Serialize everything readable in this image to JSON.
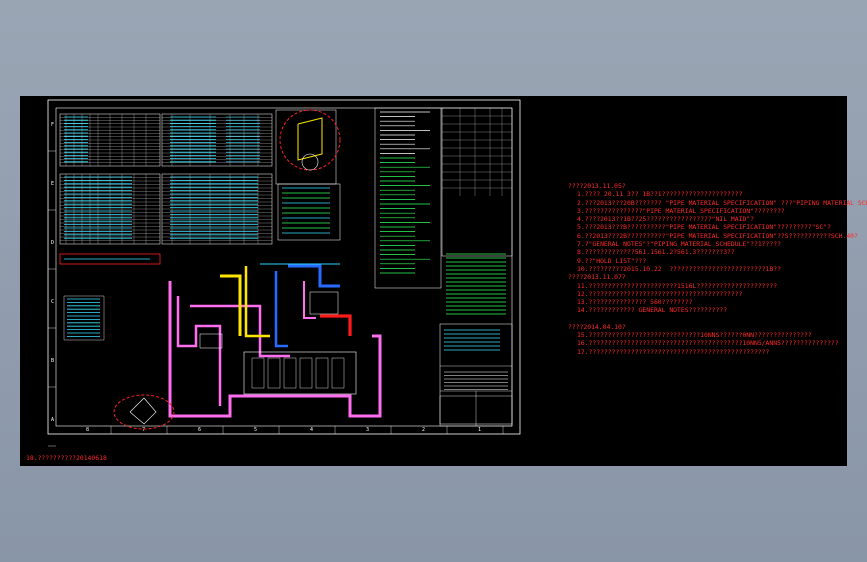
{
  "canvas": {
    "background": "#000000",
    "page_bg": "#8996a8"
  },
  "colors": {
    "frame": "#ffffff",
    "pipe_magenta": "#ff6ef0",
    "pipe_yellow": "#ffe600",
    "pipe_blue": "#2a6bff",
    "pipe_red": "#ff1a1a",
    "pipe_cyan": "#2bd4ff",
    "text_cyan": "#37e0ff",
    "text_green": "#30ff5a",
    "text_red": "#ff2a2a",
    "markup_red": "#ff2020"
  },
  "border_row_labels": [
    "F",
    "E",
    "D",
    "C",
    "B",
    "A"
  ],
  "border_col_labels": [
    "8",
    "7",
    "6",
    "5",
    "4",
    "3",
    "2",
    "1"
  ],
  "revision_notes": [
    {
      "type": "hdr",
      "text": "????2013.11.05?"
    },
    {
      "type": "itm",
      "text": "1.???? 20.11 3?? 1B??1?????????????????????"
    },
    {
      "type": "itm",
      "text": "2.???2013???20B??????? \"PIPE MATERIAL SPECIFICATION\" ???\"PIPING MATERIAL SCHEDULE\"?"
    },
    {
      "type": "itm",
      "text": "3.???????????????\"PIPE MATERIAL SPECIFICATION\"????????"
    },
    {
      "type": "itm",
      "text": "4.????2013??1B??25?????????????????\"NIL MAID\"?"
    },
    {
      "type": "itm",
      "text": "5.???2013???B??????????\"PIPE MATERIAL SPECIFICATION\"?????????\"SC\"?"
    },
    {
      "type": "itm",
      "text": "6.??2013???2B??????????\"PIPE MATERIAL SPECIFICATION\"??S???????????SCH.40?"
    },
    {
      "type": "itm",
      "text": "7.?\"GENERAL NOTES\"?\"PIPING MATERIAL SCHEDULE\"??1?????"
    },
    {
      "type": "itm",
      "text": "8.?????????????561.1561.2?561.3???????3??"
    },
    {
      "type": "itm",
      "text": "9.??\"HOLD LIST\"???"
    },
    {
      "type": "itm",
      "text": "10.?????????2015.10.22  ?????????????????????????1B??"
    },
    {
      "type": "hdr",
      "text": "????2013.11.07?"
    },
    {
      "type": "itm",
      "text": "11.???????????????????????1516L?????????????????????"
    },
    {
      "type": "itm",
      "text": "12.????????????????????????????????????????"
    },
    {
      "type": "itm",
      "text": "13.??????????????? 560????????"
    },
    {
      "type": "itm",
      "text": "14.???????????? GENERAL NOTES??????????"
    },
    {
      "type": "gap",
      "text": ""
    },
    {
      "type": "hdr",
      "text": "????2014.04.10?"
    },
    {
      "type": "itm",
      "text": "15.?????????????????????????????10NNS??????0NN???????????????"
    },
    {
      "type": "itm",
      "text": "16.????????????????????????????????????????10NN5/ANN5???????????????"
    },
    {
      "type": "itm",
      "text": "17.???????????????????????????????????????????????"
    }
  ],
  "footer_note": "18.??????????20140618"
}
